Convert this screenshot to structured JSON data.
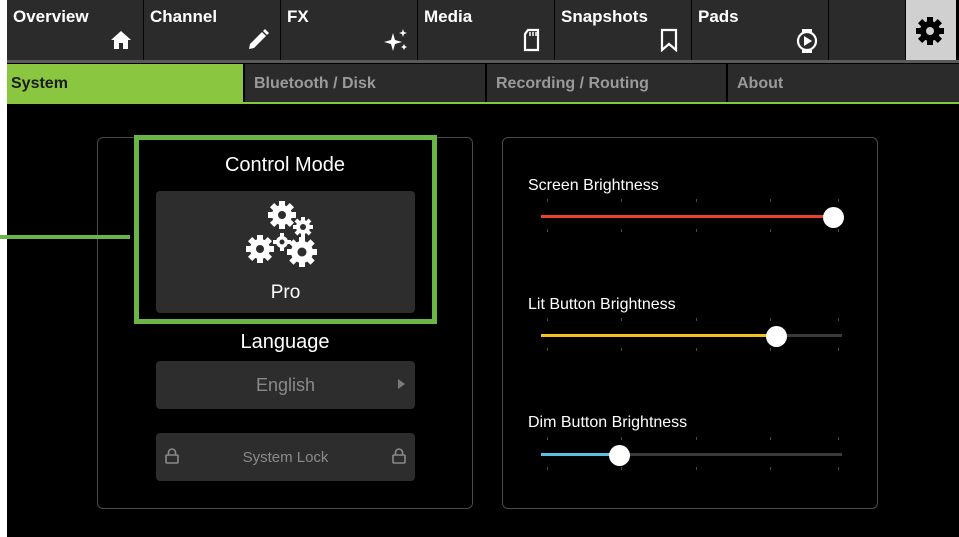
{
  "nav": {
    "tabs": [
      {
        "label": "Overview",
        "icon": "home-icon"
      },
      {
        "label": "Channel",
        "icon": "pencil-icon"
      },
      {
        "label": "FX",
        "icon": "sparkle-icon"
      },
      {
        "label": "Media",
        "icon": "sd-card-icon"
      },
      {
        "label": "Snapshots",
        "icon": "bookmark-icon"
      },
      {
        "label": "Pads",
        "icon": "pad-play-icon"
      }
    ],
    "settings_icon": "gear-icon"
  },
  "subtabs": [
    {
      "label": "System",
      "active": true
    },
    {
      "label": "Bluetooth / Disk",
      "active": false
    },
    {
      "label": "Recording / Routing",
      "active": false
    },
    {
      "label": "About",
      "active": false
    }
  ],
  "system": {
    "control_mode_title": "Control Mode",
    "control_mode_value": "Pro",
    "language_title": "Language",
    "language_value": "English",
    "system_lock_label": "System Lock"
  },
  "brightness": [
    {
      "label": "Screen Brightness",
      "level": 0.97,
      "color": "#e8412c"
    },
    {
      "label": "Lit Button Brightness",
      "level": 0.78,
      "color": "#f2c21b"
    },
    {
      "label": "Dim Button Brightness",
      "level": 0.26,
      "color": "#5bc0e8"
    }
  ],
  "colors": {
    "accent_green": "#8ac640",
    "highlight_green": "#6ab546"
  }
}
